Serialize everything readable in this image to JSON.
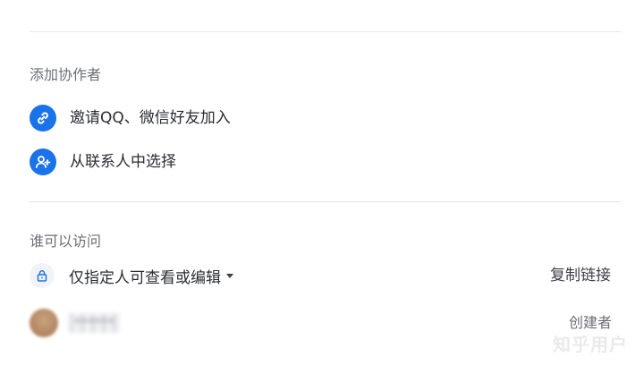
{
  "add_collaborators": {
    "title": "添加协作者",
    "options": [
      {
        "label": "邀请QQ、微信好友加入",
        "icon": "link-icon"
      },
      {
        "label": "从联系人中选择",
        "icon": "add-contact-icon"
      }
    ]
  },
  "access": {
    "title": "谁可以访问",
    "permission_label": "仅指定人可查看或编辑",
    "copy_link_label": "复制链接",
    "lock_icon": "lock-icon"
  },
  "members": [
    {
      "name": "******",
      "role": "创建者"
    }
  ],
  "watermark": "知乎用户",
  "colors": {
    "accent": "#1a73e8",
    "divider": "#e6e7ea",
    "muted_text": "#6b6f76"
  }
}
